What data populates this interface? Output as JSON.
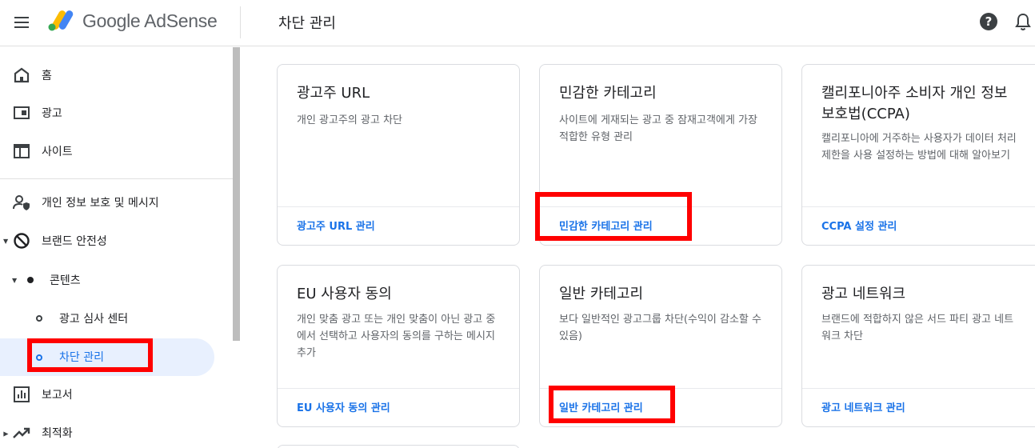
{
  "header": {
    "brand": "Google AdSense",
    "page_title": "차단 관리"
  },
  "sidebar": {
    "items": [
      {
        "label": "홈",
        "icon": "home-icon"
      },
      {
        "label": "광고",
        "icon": "ads-icon"
      },
      {
        "label": "사이트",
        "icon": "sites-icon"
      },
      {
        "label": "개인 정보 보호 및 메시지",
        "icon": "privacy-icon"
      },
      {
        "label": "브랜드 안전성",
        "icon": "block-icon"
      },
      {
        "label": "콘텐츠",
        "icon": "dot-icon"
      },
      {
        "label": "광고 심사 센터",
        "icon": "ring-icon"
      },
      {
        "label": "차단 관리",
        "icon": "ring-icon"
      },
      {
        "label": "보고서",
        "icon": "report-icon"
      },
      {
        "label": "최적화",
        "icon": "trend-icon"
      }
    ]
  },
  "cards": [
    {
      "title": "광고주 URL",
      "desc": "개인 광고주의 광고 차단",
      "link": "광고주 URL 관리"
    },
    {
      "title": "민감한 카테고리",
      "desc": "사이트에 게재되는 광고 중 잠재고객에게 가장 적합한 유형 관리",
      "link": "민감한 카테고리 관리"
    },
    {
      "title": "캘리포니아주 소비자 개인 정보 보호법(CCPA)",
      "desc": "캘리포니아에 거주하는 사용자가 데이터 처리 제한을 사용 설정하는 방법에 대해 알아보기",
      "link": "CCPA 설정 관리"
    },
    {
      "title": "EU 사용자 동의",
      "desc": "개인 맞춤 광고 또는 개인 맞춤이 아닌 광고 중에서 선택하고 사용자의 동의를 구하는 메시지 추가",
      "link": "EU 사용자 동의 관리"
    },
    {
      "title": "일반 카테고리",
      "desc": "보다 일반적인 광고그룹 차단(수익이 감소할 수 있음)",
      "link": "일반 카테고리 관리"
    },
    {
      "title": "광고 네트워크",
      "desc": "브랜드에 적합하지 않은 서드 파티 광고 네트워크 차단",
      "link": "광고 네트워크 관리"
    }
  ],
  "colors": {
    "link": "#1a73e8",
    "active_bg": "#e8f0fe",
    "highlight": "#ff0000"
  }
}
